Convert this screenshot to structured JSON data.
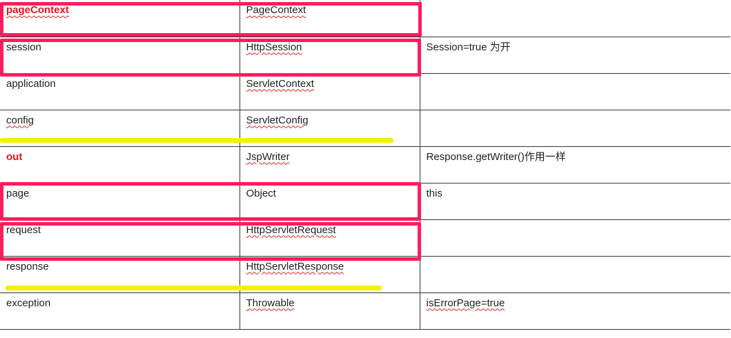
{
  "rows": [
    {
      "name": "pageContext",
      "type": "PageContext",
      "note": ""
    },
    {
      "name": "session",
      "type": "HttpSession",
      "note": "Session=true 为开"
    },
    {
      "name": "application",
      "type": "ServletContext",
      "note": ""
    },
    {
      "name": "config",
      "type": "ServletConfig",
      "note": ""
    },
    {
      "name": "out",
      "type": "JspWriter",
      "note": "Response.getWriter()作用一样"
    },
    {
      "name": "page",
      "type": "Object",
      "note": "this"
    },
    {
      "name": "request",
      "type": "HttpServletRequest",
      "note": ""
    },
    {
      "name": "response",
      "type": "HttpServletResponse",
      "note": ""
    },
    {
      "name": "exception",
      "type": "Throwable",
      "note": "isErrorPage=true"
    }
  ],
  "colors": {
    "highlight_box": "#ff1c5c",
    "highlight_line": "#f4f000",
    "emphasis_text": "#e8141c"
  }
}
